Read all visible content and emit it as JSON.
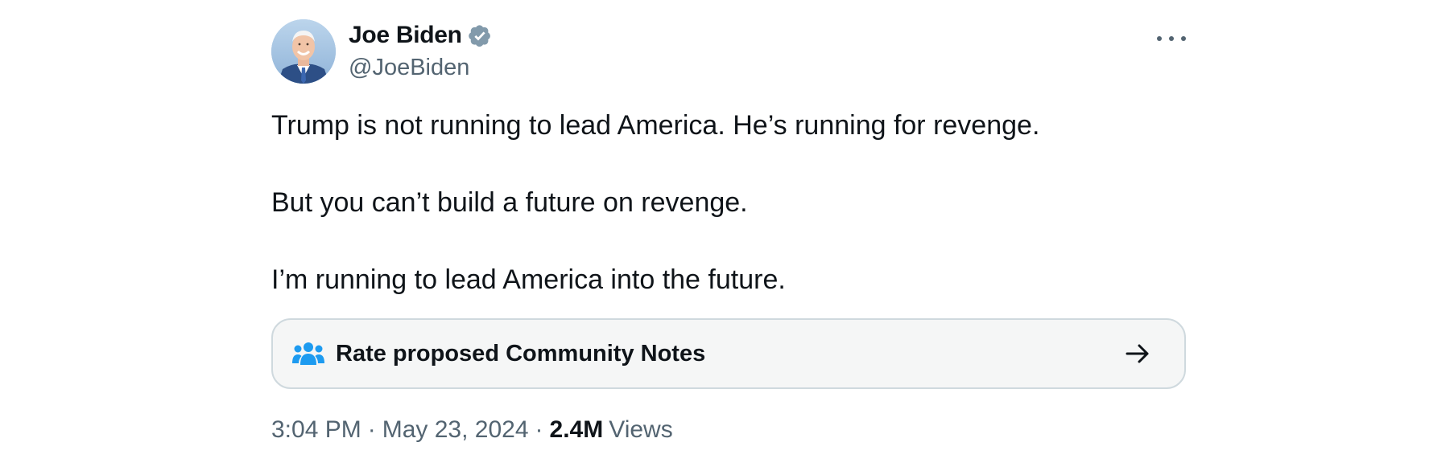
{
  "author": {
    "display_name": "Joe Biden",
    "handle": "@JoeBiden",
    "verified_icon": "verified-badge-icon",
    "avatar": "profile-photo"
  },
  "tweet": {
    "lines": [
      "Trump is not running to lead America. He’s running for revenge.",
      "But you can’t build a future on revenge.",
      "I’m running to lead America into the future."
    ]
  },
  "community_notes": {
    "label": "Rate proposed Community Notes",
    "icon": "people-icon",
    "arrow_icon": "arrow-right-icon",
    "icon_color": "#1d9bf0"
  },
  "meta": {
    "time": "3:04 PM",
    "separator": "·",
    "date": "May 23, 2024",
    "views_count": "2.4M",
    "views_label": "Views"
  },
  "colors": {
    "text_primary": "#0f1419",
    "text_secondary": "#536471",
    "verified_badge": "#829aab",
    "card_border": "#cfd9de",
    "card_background": "#f5f6f6"
  }
}
